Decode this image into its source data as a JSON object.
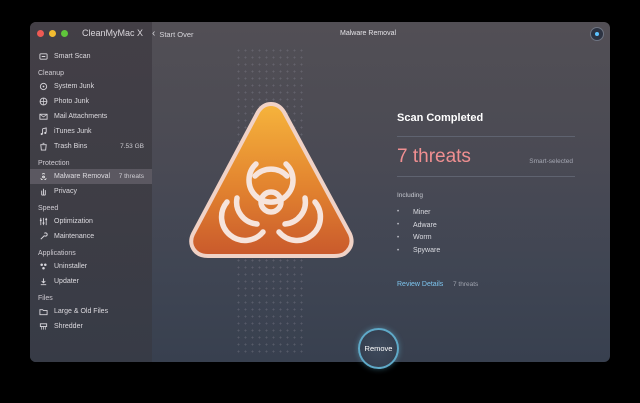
{
  "window": {
    "app_title": "CleanMyMac X",
    "back_label": "Start Over",
    "header_title": "Malware Removal"
  },
  "sidebar": {
    "top_item": {
      "label": "Smart Scan",
      "icon": "smart-scan-icon"
    },
    "sections": [
      {
        "label": "Cleanup",
        "items": [
          {
            "label": "System Junk",
            "icon": "system-junk-icon",
            "meta": ""
          },
          {
            "label": "Photo Junk",
            "icon": "photo-junk-icon",
            "meta": ""
          },
          {
            "label": "Mail Attachments",
            "icon": "mail-icon",
            "meta": ""
          },
          {
            "label": "iTunes Junk",
            "icon": "music-icon",
            "meta": ""
          },
          {
            "label": "Trash Bins",
            "icon": "trash-icon",
            "meta": "7.53 GB"
          }
        ]
      },
      {
        "label": "Protection",
        "items": [
          {
            "label": "Malware Removal",
            "icon": "biohazard-icon",
            "meta": "7 threats",
            "active": true
          },
          {
            "label": "Privacy",
            "icon": "hand-icon",
            "meta": ""
          }
        ]
      },
      {
        "label": "Speed",
        "items": [
          {
            "label": "Optimization",
            "icon": "sliders-icon",
            "meta": ""
          },
          {
            "label": "Maintenance",
            "icon": "wrench-icon",
            "meta": ""
          }
        ]
      },
      {
        "label": "Applications",
        "items": [
          {
            "label": "Uninstaller",
            "icon": "uninstaller-icon",
            "meta": ""
          },
          {
            "label": "Updater",
            "icon": "updater-icon",
            "meta": ""
          }
        ]
      },
      {
        "label": "Files",
        "items": [
          {
            "label": "Large & Old Files",
            "icon": "folder-icon",
            "meta": ""
          },
          {
            "label": "Shredder",
            "icon": "shredder-icon",
            "meta": ""
          }
        ]
      }
    ]
  },
  "main": {
    "scan_title": "Scan Completed",
    "threat_count": "7 threats",
    "smart_selected": "Smart-selected",
    "including_label": "Including",
    "threats": [
      "Miner",
      "Adware",
      "Worm",
      "Spyware"
    ],
    "review_label": "Review Details",
    "review_count": "7 threats",
    "remove_label": "Remove"
  },
  "colors": {
    "accent_blue": "#7dc5ef",
    "threat_pink": "#f08f91",
    "hazard_orange": "#e58a32"
  }
}
